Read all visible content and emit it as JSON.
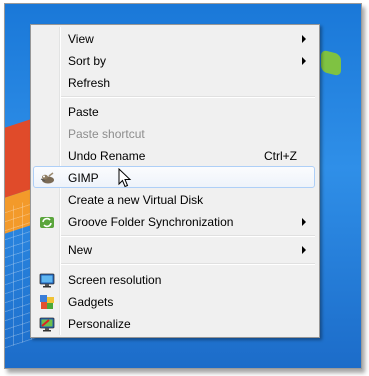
{
  "menu": {
    "items": [
      {
        "label": "View",
        "submenu": true
      },
      {
        "label": "Sort by",
        "submenu": true
      },
      {
        "label": "Refresh"
      },
      {
        "label": "Paste"
      },
      {
        "label": "Paste shortcut",
        "disabled": true
      },
      {
        "label": "Undo Rename",
        "shortcut": "Ctrl+Z"
      },
      {
        "label": "GIMP",
        "icon": "gimp-icon",
        "highlighted": true
      },
      {
        "label": "Create a new Virtual Disk"
      },
      {
        "label": "Groove Folder Synchronization",
        "icon": "groove-sync-icon",
        "submenu": true
      },
      {
        "label": "New",
        "submenu": true
      },
      {
        "label": "Screen resolution",
        "icon": "monitor-icon"
      },
      {
        "label": "Gadgets",
        "icon": "gadgets-icon"
      },
      {
        "label": "Personalize",
        "icon": "personalize-icon"
      }
    ]
  },
  "colors": {
    "menu_bg": "#f0f0f0",
    "highlight_border": "#aecff7",
    "disabled_text": "#8d8d8d",
    "desktop": "#1a78d8"
  }
}
